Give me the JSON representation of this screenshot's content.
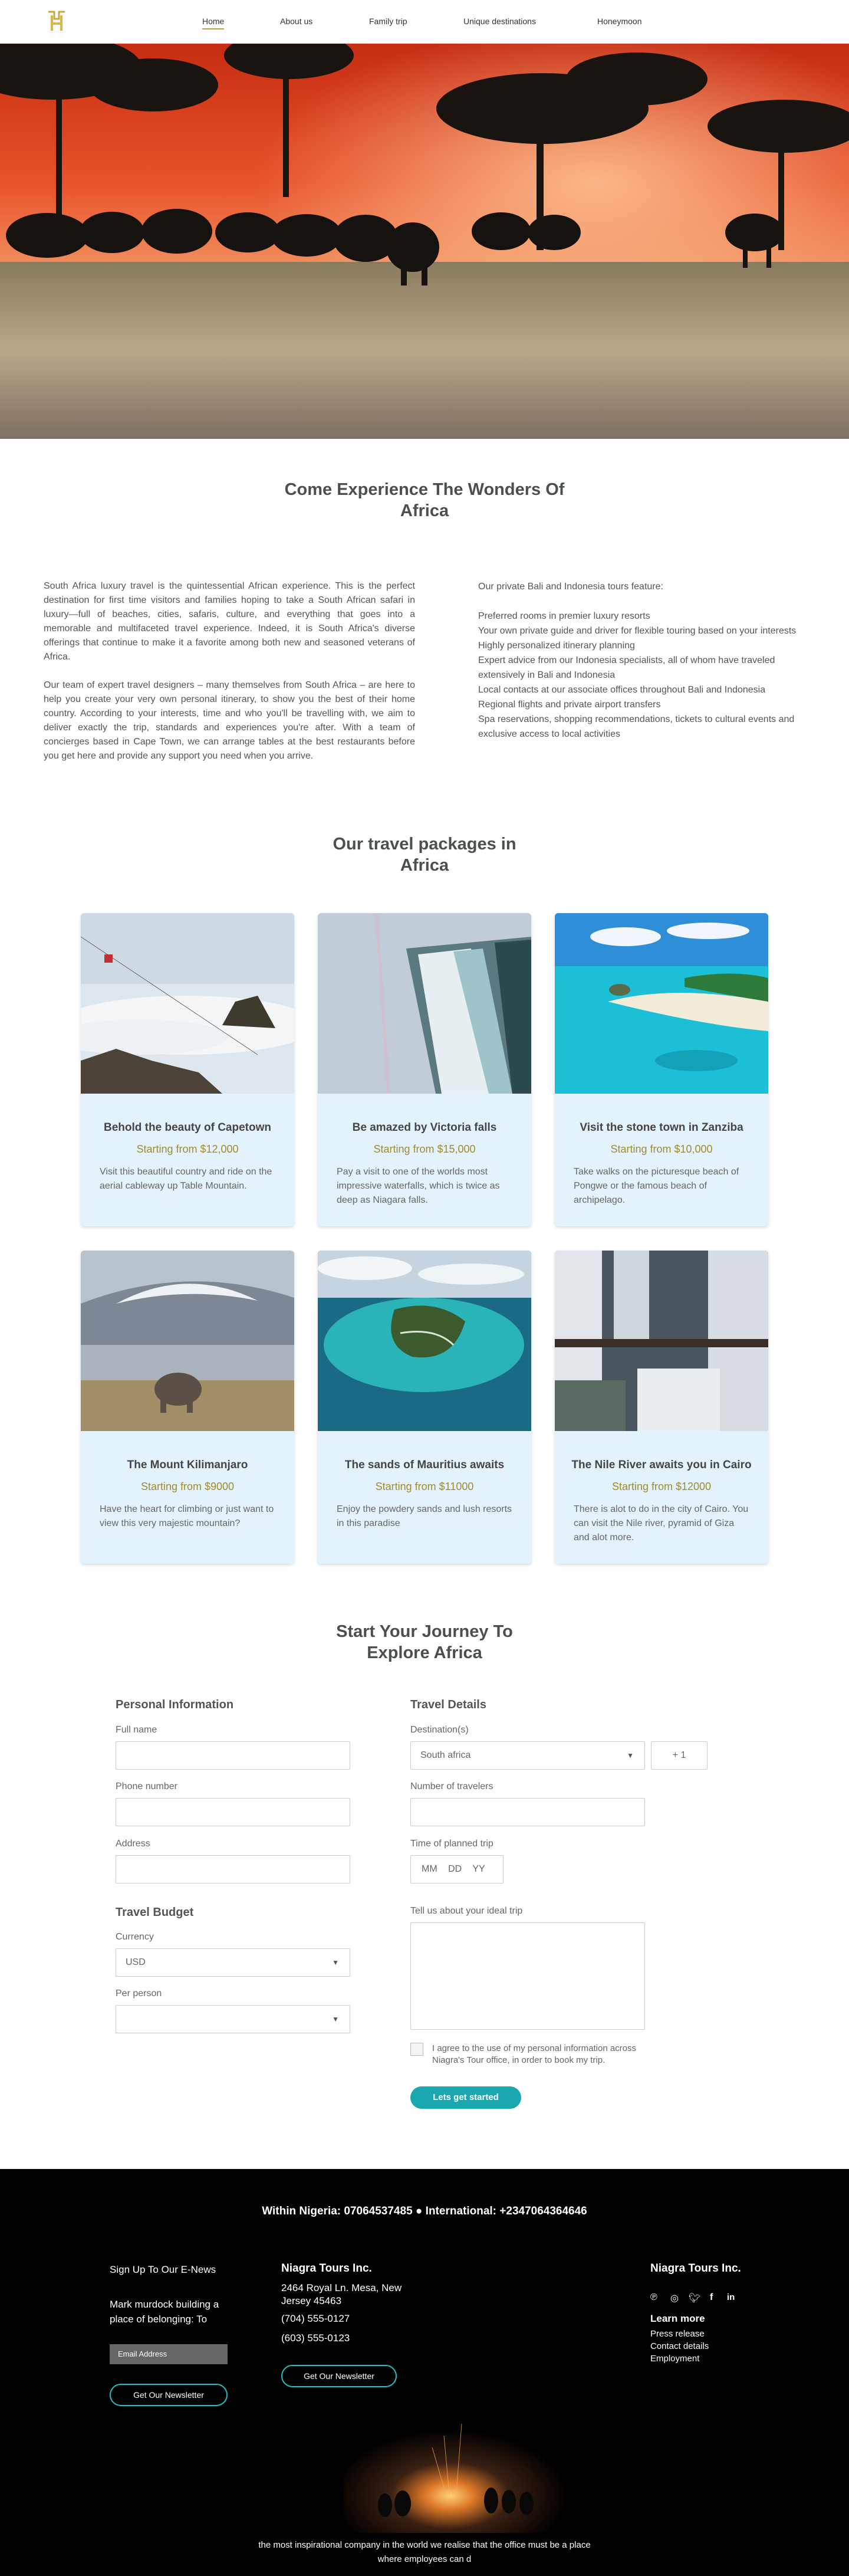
{
  "header": {
    "nav": [
      {
        "label": "Home"
      },
      {
        "label": "About us"
      },
      {
        "label": "Family trip"
      },
      {
        "label": "Unique destinations"
      },
      {
        "label": "Honeymoon"
      }
    ]
  },
  "intro": {
    "title_line1": "Come Experience The Wonders Of",
    "title_line2": "Africa",
    "left_p1": "South Africa luxury travel is the quintessential African experience. This is the perfect destination for first time visitors and families hoping to take a South African safari in luxury—full of beaches, cities, safaris, culture, and everything that goes into a memorable and multifaceted travel experience. Indeed, it is South Africa's diverse offerings that continue to make it a favorite among both new and seasoned veterans of Africa.",
    "left_p2": "Our team of expert travel designers – many themselves from South Africa – are here to help you create your very own personal itinerary, to show you the best of their home country. According to your interests, time and who you'll be travelling with, we aim to deliver exactly the trip, standards and experiences you're after. With a team of concierges based in Cape Town, we can arrange tables at the best restaurants before you get here and provide any support you need when you arrive.",
    "right_heading": "Our private Bali and Indonesia tours feature:",
    "right_items": [
      "Preferred rooms in premier luxury resorts",
      "Your own private guide and driver for flexible touring based on your interests",
      "Highly personalized itinerary planning",
      "Expert advice from our Indonesia specialists, all of whom have traveled extensively in Bali and Indonesia",
      "Local contacts at our associate offices throughout Bali and Indonesia",
      "Regional flights and private airport transfers",
      "Spa reservations, shopping recommendations, tickets to cultural events and exclusive access to local activities"
    ]
  },
  "packages": {
    "title_line1": "Our travel packages in",
    "title_line2": "Africa",
    "cards": [
      {
        "title": "Behold the beauty of Capetown",
        "price": "Starting from $12,000",
        "desc": "Visit this beautiful country and ride on the aerial cableway up Table Mountain."
      },
      {
        "title": "Be amazed by  Victoria falls",
        "price": "Starting from $15,000",
        "desc": "Pay a visit to one of the worlds most impressive waterfalls, which is twice as deep as Niagara falls."
      },
      {
        "title": "Visit the stone town in Zanziba",
        "price": "Starting from $10,000",
        "desc": "Take walks on the picturesque beach of Pongwe or the famous beach of archipelago."
      },
      {
        "title": "The Mount Kilimanjaro",
        "price": "Starting from $9000",
        "desc": "Have the heart for climbing or just want to view this very majestic mountain?"
      },
      {
        "title": "The sands of Mauritius awaits",
        "price": "Starting from $11000",
        "desc": "Enjoy the powdery sands and lush resorts in this paradise"
      },
      {
        "title": "The Nile River awaits you in Cairo",
        "price": "Starting from $12000",
        "desc": "There is alot to do in the city of Cairo. You can visit the Nile river, pyramid of Giza and alot more."
      }
    ]
  },
  "form": {
    "title_line1": "Start Your Journey To",
    "title_line2": "Explore Africa",
    "personal_heading": "Personal Information",
    "full_name_label": "Full name",
    "phone_label": "Phone number",
    "address_label": "Address",
    "budget_heading": "Travel Budget",
    "currency_label": "Currency",
    "currency_value": "USD",
    "per_person_label": "Per person",
    "travel_heading": "Travel Details",
    "destination_label": "Destination(s)",
    "destination_value": "South africa",
    "add_destination": "+ 1",
    "travelers_label": "Number of travelers",
    "time_label": "Time of planned trip",
    "date_mm": "MM",
    "date_dd": "DD",
    "date_yy": "YY",
    "ideal_trip_label": "Tell us about your ideal trip",
    "consent_line1": "I agree to the use of my personal information across",
    "consent_line2": "Niagra's Tour office, in order to book my trip.",
    "submit_label": "Lets get started"
  },
  "footer": {
    "phones": "Within Nigeria: 07064537485  ●  International: +2347064364646",
    "signup_heading": "Sign Up To Our E-News",
    "signup_text_line1": "Mark murdock building a",
    "signup_text_line2": "place of belonging: To",
    "email_placeholder": "Email Address",
    "newsletter_btn_1": "Get Our Newsletter",
    "company_name": "Niagra Tours Inc.",
    "address_line1": "2464 Royal Ln. Mesa, New",
    "address_line2": "Jersey 45463",
    "phone1": "(704) 555-0127",
    "phone2": "(603) 555-0123",
    "newsletter_btn_2": "Get Our Newsletter",
    "right_company": "Niagra Tours Inc.",
    "learn_more": "Learn more",
    "links": [
      "Press release",
      "Contact details",
      "Employment"
    ],
    "tagline_line1": "the most inspirational company in the world we realise that the office must be a place",
    "tagline_line2": "where employees can d"
  }
}
